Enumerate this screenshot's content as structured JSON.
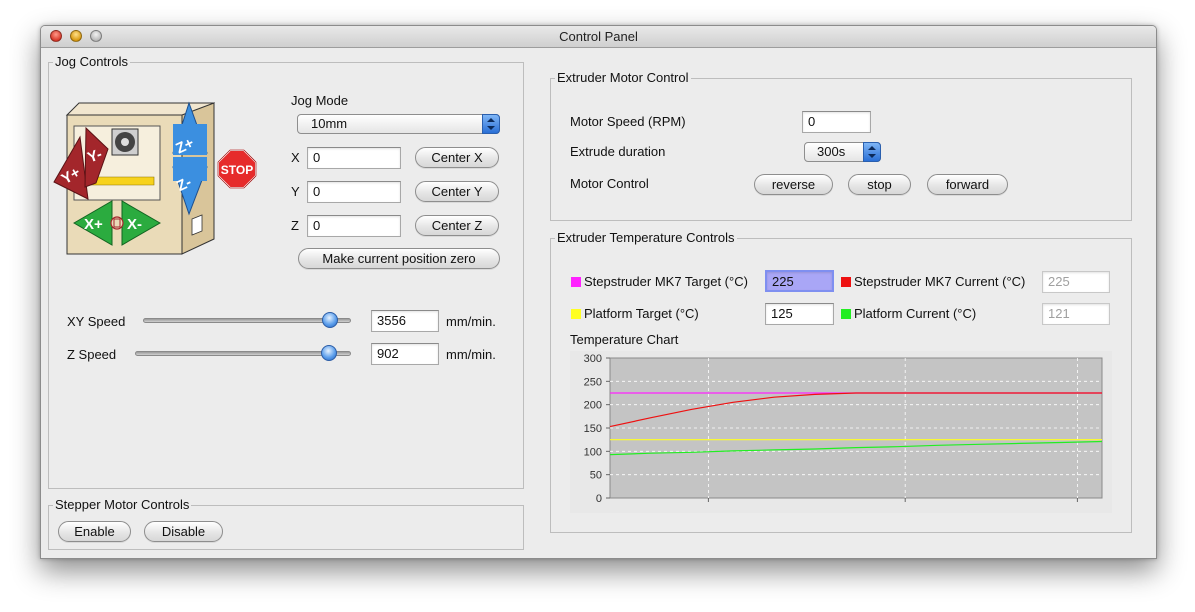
{
  "window": {
    "title": "Control Panel"
  },
  "jog": {
    "group_title": "Jog Controls",
    "mode_label": "Jog Mode",
    "mode_value": "10mm",
    "axes": [
      {
        "label": "X",
        "value": "0",
        "button": "Center X"
      },
      {
        "label": "Y",
        "value": "0",
        "button": "Center Y"
      },
      {
        "label": "Z",
        "value": "0",
        "button": "Center Z"
      }
    ],
    "zero_button": "Make current position zero",
    "xy_speed": {
      "label": "XY Speed",
      "value": "3556",
      "unit": "mm/min.",
      "slider_fraction": 0.9
    },
    "z_speed": {
      "label": "Z Speed",
      "value": "902",
      "unit": "mm/min.",
      "slider_fraction": 0.9
    },
    "pad": {
      "y_plus": "Y+",
      "y_minus": "Y-",
      "x_plus": "X+",
      "x_minus": "X-",
      "z_plus": "Z+",
      "z_minus": "Z-",
      "stop": "STOP"
    }
  },
  "stepper": {
    "group_title": "Stepper Motor Controls",
    "enable": "Enable",
    "disable": "Disable"
  },
  "motor": {
    "group_title": "Extruder Motor Control",
    "speed_label": "Motor Speed (RPM)",
    "speed_value": "0",
    "duration_label": "Extrude duration",
    "duration_value": "300s",
    "control_label": "Motor Control",
    "reverse": "reverse",
    "stop": "stop",
    "forward": "forward"
  },
  "temp": {
    "group_title": "Extruder Temperature Controls",
    "target_label": "Stepstruder MK7 Target (°C)",
    "target_value": "225",
    "current_label": "Stepstruder MK7 Current (°C)",
    "current_value": "225",
    "platform_target_label": "Platform Target (°C)",
    "platform_target_value": "125",
    "platform_current_label": "Platform Current (°C)",
    "platform_current_value": "121",
    "chart_label": "Temperature Chart",
    "colors": {
      "target": "#ff22ff",
      "current": "#ee1111",
      "platform_target": "#ffff22",
      "platform_current": "#22ee22"
    }
  },
  "chart_data": {
    "type": "line",
    "ylim": [
      0,
      300
    ],
    "yticks": [
      0,
      50,
      100,
      150,
      200,
      250,
      300
    ],
    "grid": true,
    "series": [
      {
        "values": [
          225,
          225,
          225,
          225,
          225,
          225,
          225,
          225,
          225,
          225,
          225,
          225,
          225
        ],
        "color": "#ff22ff"
      },
      {
        "values": [
          153,
          172,
          190,
          205,
          216,
          222,
          225,
          225,
          225,
          225,
          225,
          225,
          225
        ],
        "color": "#ee1111"
      },
      {
        "values": [
          125,
          125,
          125,
          125,
          125,
          125,
          125,
          125,
          125,
          125,
          125,
          125,
          125
        ],
        "color": "#ffff22"
      },
      {
        "values": [
          93,
          96,
          98,
          101,
          103,
          105,
          108,
          110,
          113,
          115,
          117,
          119,
          121
        ],
        "color": "#22ee22"
      }
    ]
  }
}
